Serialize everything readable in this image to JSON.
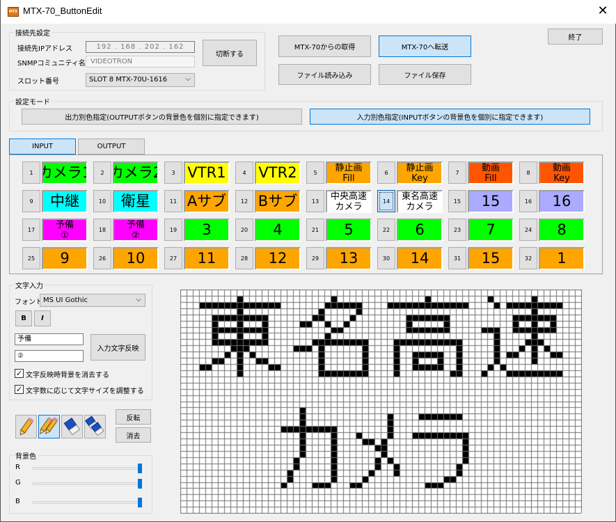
{
  "window": {
    "title": "MTX-70_ButtonEdit",
    "icon_text": "MTX",
    "close": "✕"
  },
  "connection": {
    "group_label": "接続先設定",
    "ip_label": "接続先IPアドレス",
    "ip_value": "192 . 168 . 202 . 162",
    "snmp_label": "SNMPコミュニティ名",
    "snmp_value": "VIDEOTRON",
    "slot_label": "スロット番号",
    "slot_value": "SLOT 8  MTX-70U-1616",
    "disconnect": "切断する"
  },
  "actions": {
    "get": "MTX-70からの取得",
    "send": "MTX-70へ転送",
    "load": "ファイル読み込み",
    "save": "ファイル保存",
    "exit": "終了"
  },
  "mode": {
    "group_label": "設定モード",
    "output_mode": "出力別色指定(OUTPUTボタンの背景色を個別に指定できます)",
    "input_mode": "入力別色指定(INPUTボタンの背景色を個別に指定できます)"
  },
  "tabs": [
    {
      "label": "INPUT",
      "active": true
    },
    {
      "label": "OUTPUT",
      "active": false
    }
  ],
  "buttons": [
    {
      "n": "1",
      "label": "カメラ1",
      "color": "#00ff00"
    },
    {
      "n": "2",
      "label": "カメラ2",
      "color": "#00ff00"
    },
    {
      "n": "3",
      "label": "VTR1",
      "color": "#ffff00"
    },
    {
      "n": "4",
      "label": "VTR2",
      "color": "#ffff00"
    },
    {
      "n": "5",
      "label": "静止画\nFill",
      "color": "#ffa500"
    },
    {
      "n": "6",
      "label": "静止画\nKey",
      "color": "#ffa500"
    },
    {
      "n": "7",
      "label": "動画\nFill",
      "color": "#ff5500"
    },
    {
      "n": "8",
      "label": "動画\nKey",
      "color": "#ff5500"
    },
    {
      "n": "9",
      "label": "中継",
      "color": "#00ffff"
    },
    {
      "n": "10",
      "label": "衛星",
      "color": "#00ffff"
    },
    {
      "n": "11",
      "label": "Aサブ",
      "color": "#ffa500"
    },
    {
      "n": "12",
      "label": "Bサブ",
      "color": "#ffa500"
    },
    {
      "n": "13",
      "label": "中央高速\nカメラ",
      "color": "#ffffff"
    },
    {
      "n": "14",
      "label": "東名高速\nカメラ",
      "color": "#ffffff",
      "focused": true
    },
    {
      "n": "15",
      "label": "15",
      "color": "#aaaaff"
    },
    {
      "n": "16",
      "label": "16",
      "color": "#aaaaff"
    },
    {
      "n": "17",
      "label": "予備\n①",
      "color": "#ff00ff"
    },
    {
      "n": "18",
      "label": "予備\n②",
      "color": "#ff00ff"
    },
    {
      "n": "19",
      "label": "3",
      "color": "#00ff00"
    },
    {
      "n": "20",
      "label": "4",
      "color": "#00ff00"
    },
    {
      "n": "21",
      "label": "5",
      "color": "#00ff00"
    },
    {
      "n": "22",
      "label": "6",
      "color": "#00ff00"
    },
    {
      "n": "23",
      "label": "7",
      "color": "#00ff00"
    },
    {
      "n": "24",
      "label": "8",
      "color": "#00ff00"
    },
    {
      "n": "25",
      "label": "9",
      "color": "#ffa500"
    },
    {
      "n": "26",
      "label": "10",
      "color": "#ffa500"
    },
    {
      "n": "27",
      "label": "11",
      "color": "#ffa500"
    },
    {
      "n": "28",
      "label": "12",
      "color": "#ffa500"
    },
    {
      "n": "29",
      "label": "13",
      "color": "#ffa500"
    },
    {
      "n": "30",
      "label": "14",
      "color": "#ffa500"
    },
    {
      "n": "31",
      "label": "15",
      "color": "#ffa500"
    },
    {
      "n": "32",
      "label": "1",
      "color": "#ffa500"
    }
  ],
  "text_input": {
    "group_label": "文字入力",
    "font_label": "フォント",
    "font_value": "MS UI Gothic",
    "bold": "B",
    "italic": "I",
    "line1": "予備",
    "line2": "②",
    "apply": "入力文字反映",
    "check1": {
      "label": "文字反映時背景を消去する",
      "checked": true
    },
    "check2": {
      "label": "文字数に応じて文字サイズを調整する",
      "checked": true
    }
  },
  "tools": [
    {
      "icon": "pencil-icon",
      "selected": false
    },
    {
      "icon": "double-pencil-icon",
      "selected": true
    },
    {
      "icon": "eraser-icon",
      "selected": false
    },
    {
      "icon": "double-eraser-icon",
      "selected": false
    }
  ],
  "invert": "反転",
  "clear": "消去",
  "background": {
    "group_label": "背景色",
    "sliders": [
      {
        "label": "R",
        "value": 255
      },
      {
        "label": "G",
        "value": 255
      },
      {
        "label": "B",
        "value": 255
      }
    ],
    "max": 255
  },
  "bitmap": {
    "cols": 64,
    "rows": 36,
    "on_color": "#000000",
    "off_color": "#ffffff",
    "grid_color": "#707070",
    "filled": {
      "1": [
        "9",
        "24",
        "39",
        "49",
        "56"
      ],
      "2": [
        "3-15",
        "23-28",
        "33-45",
        "50",
        "52-60"
      ],
      "3": [
        "9",
        "22",
        "28",
        "56"
      ],
      "4": [
        "5-13",
        "21-22",
        "27",
        "36-42",
        "53-59"
      ],
      "5": [
        "5",
        "9",
        "13",
        "19-20",
        "23",
        "26",
        "36",
        "42",
        "53",
        "56",
        "59"
      ],
      "6": [
        "5-13",
        "24-25",
        "36-42",
        "48-50",
        "53-59"
      ],
      "7": [
        "5",
        "9",
        "13",
        "23",
        "50",
        "56"
      ],
      "8": [
        "5-13",
        "21-29",
        "34-44",
        "50",
        "55-57"
      ],
      "9": [
        "8-10",
        "18-20",
        "22",
        "29",
        "34",
        "44",
        "50",
        "54",
        "56",
        "58"
      ],
      "10": [
        "7",
        "9",
        "11",
        "22",
        "29",
        "34",
        "37-41",
        "44",
        "50",
        "52-53",
        "56",
        "59-60"
      ],
      "11": [
        "5-6",
        "9",
        "12-13",
        "22",
        "29",
        "34",
        "37",
        "41",
        "44",
        "50",
        "56"
      ],
      "12": [
        "3-4",
        "9",
        "14-15",
        "22",
        "29",
        "34",
        "37-41",
        "44",
        "49",
        "51"
      ],
      "13": [
        "9",
        "22-29",
        "34",
        "43-44",
        "48",
        "52-60"
      ],
      "19": [
        "19"
      ],
      "20": [
        "19",
        "33",
        "38-44"
      ],
      "21": [
        "19",
        "33"
      ],
      "22": [
        "16-24",
        "33"
      ],
      "23": [
        "19",
        "24",
        "28",
        "33",
        "37-45"
      ],
      "24": [
        "19",
        "24",
        "29-30",
        "32",
        "45"
      ],
      "25": [
        "19",
        "24",
        "31-32",
        "45"
      ],
      "26": [
        "19",
        "24",
        "32",
        "45"
      ],
      "27": [
        "18",
        "24",
        "31",
        "33",
        "45"
      ],
      "28": [
        "18",
        "24",
        "31",
        "34",
        "44"
      ],
      "29": [
        "17",
        "24",
        "30",
        "34",
        "44"
      ],
      "30": [
        "17",
        "24",
        "29",
        "42-43"
      ],
      "31": [
        "16",
        "21-23",
        "27-28",
        "39-41"
      ]
    }
  }
}
